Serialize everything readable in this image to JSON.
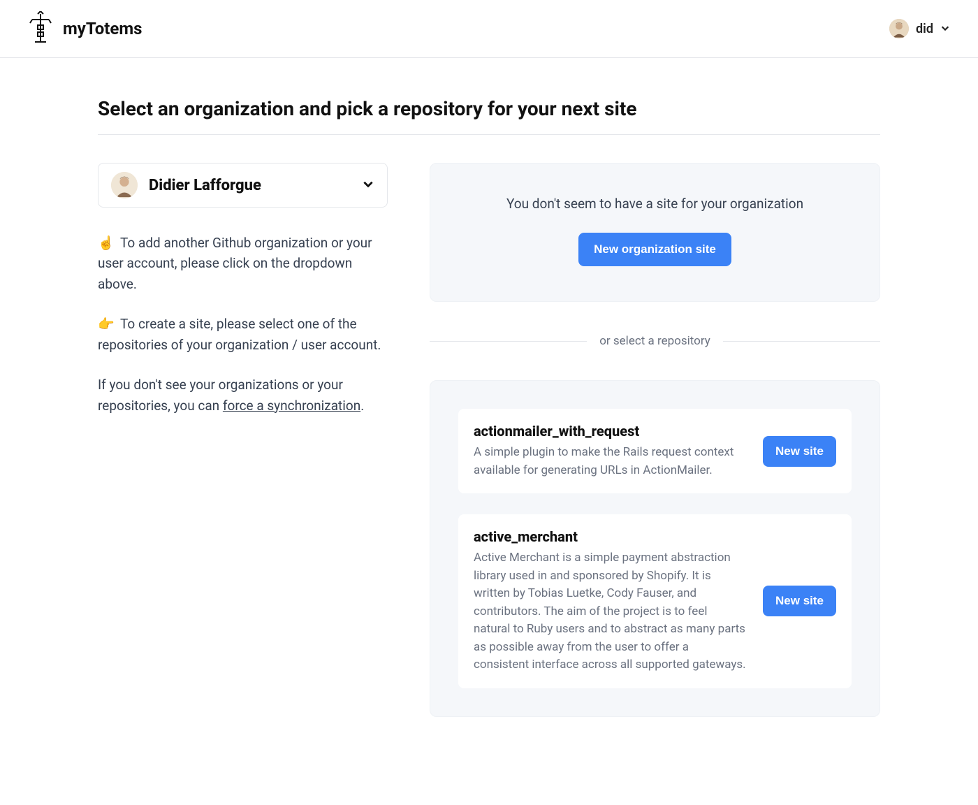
{
  "header": {
    "brand": "myTotems",
    "username": "did"
  },
  "page": {
    "title": "Select an organization and pick a repository for your next site"
  },
  "org_selector": {
    "selected": "Didier Lafforgue"
  },
  "help": {
    "p1_emoji": "☝️",
    "p1_text": "To add another Github organization or your user account, please click on the dropdown above.",
    "p2_emoji": "👉",
    "p2_text": "To create a site, please select one of the repositories of your organization / user account.",
    "p3_prefix": "If you don't see your organizations or your repositories, you can ",
    "p3_link": "force a synchronization",
    "p3_suffix": "."
  },
  "empty_state": {
    "message": "You don't seem to have a site for your organization",
    "button": "New organization site"
  },
  "divider": {
    "label": "or select a repository"
  },
  "repos": [
    {
      "name": "actionmailer_with_request",
      "desc": "A simple plugin to make the Rails request context available for generating URLs in ActionMailer.",
      "button": "New site"
    },
    {
      "name": "active_merchant",
      "desc": "Active Merchant is a simple payment abstraction library used in and sponsored by Shopify. It is written by Tobias Luetke, Cody Fauser, and contributors. The aim of the project is to feel natural to Ruby users and to abstract as many parts as possible away from the user to offer a consistent interface across all supported gateways.",
      "button": "New site"
    }
  ]
}
